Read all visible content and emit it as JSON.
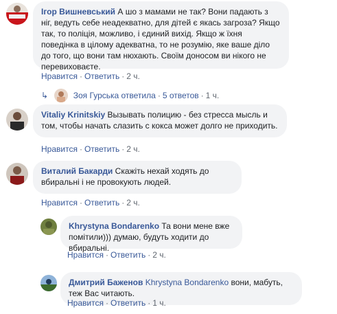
{
  "comments": [
    {
      "author": "Ігор Вишневський",
      "text": "А шо з мамами не так? Вони падають з ніг, ведуть себе неадекватно, для дітей є якась загроза? Якщо так, то поліція, можливо, і єдиний вихід. Якщо ж їхня поведінка в цілому адекватна, то не розумію, яке ваше діло до того, що вони там нюхають. Своїм доносом ви нікого не перевиховаєте.",
      "like": "Нравится",
      "reply": "Ответить",
      "time": "2 ч.",
      "replies_summary": {
        "name": "Зоя Гурська ответила",
        "count": "5 ответов",
        "time": "1 ч."
      }
    },
    {
      "author": "Vitaliy Krinitskiy",
      "text": "Вызывать полицию - без стресса мысль и том, чтобы начать слазить с кокса может долго не приходить.",
      "like": "Нравится",
      "reply": "Ответить",
      "time": "2 ч."
    },
    {
      "author": "Виталий Бакарди",
      "text": "Скажіть нехай ходять до вбиральні і не провокують людей.",
      "like": "Нравится",
      "reply": "Ответить",
      "time": "2 ч.",
      "replies": [
        {
          "author": "Khrystyna Bondarenko",
          "text": "Та вони мене вже помітили))) думаю, будуть ходити до вбиральні.",
          "like": "Нравится",
          "reply": "Ответить",
          "time": "2 ч."
        },
        {
          "author": "Дмитрий Баженов",
          "mention": "Khrystyna Bondarenko",
          "text": "вони, мабуть, теж Вас читають.",
          "like": "Нравится",
          "reply": "Ответить",
          "time": "1 ч."
        }
      ]
    }
  ],
  "colors": {
    "link": "#385898",
    "bubble": "#f2f3f5",
    "meta": "#606770"
  },
  "icons": {
    "reply_arrow": "reply-arrow-icon"
  }
}
